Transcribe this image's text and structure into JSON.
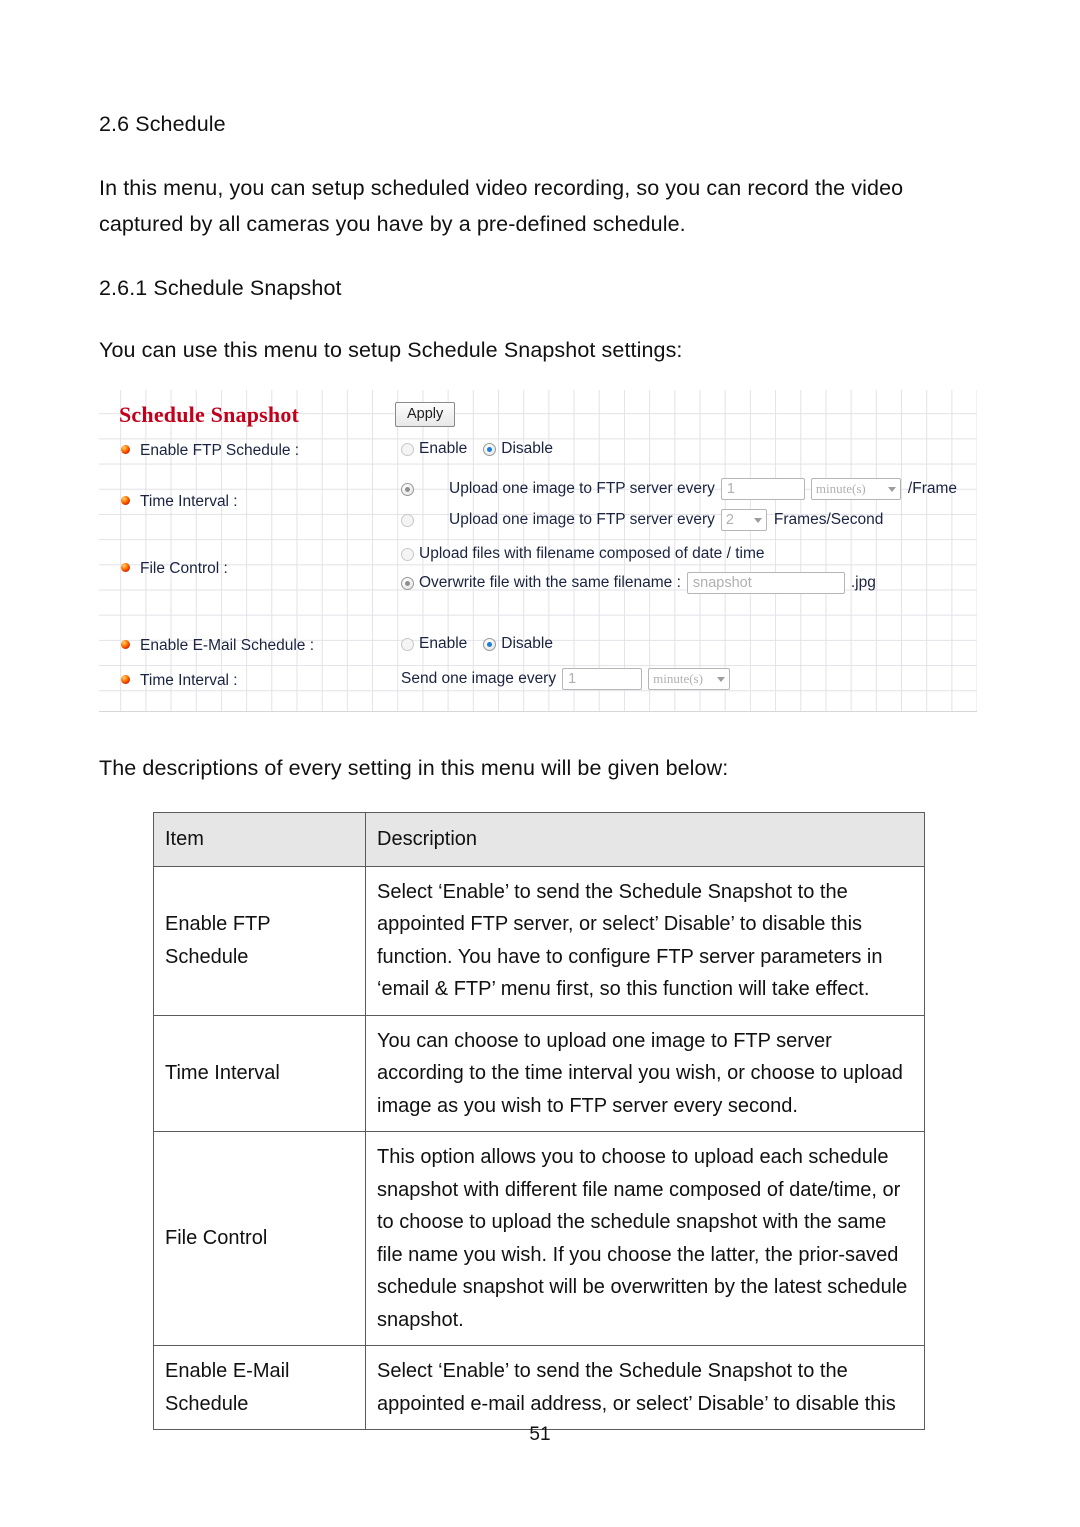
{
  "document": {
    "heading_main": "2.6 Schedule",
    "paragraph_intro": "In this menu, you can setup scheduled video recording, so you can record the video captured by all cameras you have by a pre-defined schedule.",
    "heading_sub": "2.6.1 Schedule Snapshot",
    "paragraph_usemenu": "You can use this menu to setup Schedule Snapshot settings:",
    "paragraph_descriptions": "The descriptions of every setting in this menu will be given below:",
    "page_number": "51"
  },
  "ui_panel": {
    "title": "Schedule Snapshot",
    "title_color": "#c3001b",
    "apply_label": "Apply",
    "labels": {
      "enable_ftp_schedule": "Enable FTP Schedule :",
      "time_interval": "Time Interval :",
      "file_control": "File Control :",
      "enable_email_schedule": "Enable E-Mail Schedule :",
      "time_interval_2": "Time Interval :"
    },
    "ftp_schedule": {
      "enable_label": "Enable",
      "disable_label": "Disable",
      "selected": "Disable"
    },
    "time_interval": {
      "option_minutes_label": "Upload one image to FTP server every",
      "minutes_value": "1",
      "minutes_unit": "minute(s)",
      "minutes_suffix": "/Frame",
      "option_fps_label": "Upload one image to FTP server every",
      "fps_value": "2",
      "fps_suffix": "Frames/Second",
      "selected": "minutes"
    },
    "file_control": {
      "option_datetime_label": "Upload files with filename composed of date / time",
      "option_overwrite_label": "Overwrite file with the same filename :",
      "filename_value": "snapshot",
      "filename_extension": ".jpg",
      "selected": "overwrite"
    },
    "email_schedule": {
      "enable_label": "Enable",
      "disable_label": "Disable",
      "selected": "Disable"
    },
    "email_interval": {
      "prefix_label": "Send one image every",
      "value": "1",
      "unit": "minute(s)"
    }
  },
  "table": {
    "headers": {
      "item": "Item",
      "description": "Description"
    },
    "rows": [
      {
        "item": "Enable FTP Schedule",
        "description": "Select ‘Enable’ to send the Schedule Snapshot to the appointed FTP server, or select’ Disable’ to disable this function. You have to configure FTP server parameters in ‘email & FTP’ menu first, so this function will take effect."
      },
      {
        "item": "Time Interval",
        "description": "You can choose to upload one image to FTP server according to the time interval you wish, or choose to upload image as you wish to FTP server every second."
      },
      {
        "item": "File Control",
        "description": "This option allows you to choose to upload each schedule snapshot with different file name composed of date/time, or to choose to upload the schedule snapshot with the same file name you wish. If you choose the latter, the prior-saved schedule snapshot will be overwritten by the latest schedule snapshot."
      },
      {
        "item": "Enable E-Mail Schedule",
        "description": "Select ‘Enable’ to send the Schedule Snapshot to the appointed e-mail address, or select’ Disable’ to disable this"
      }
    ]
  }
}
